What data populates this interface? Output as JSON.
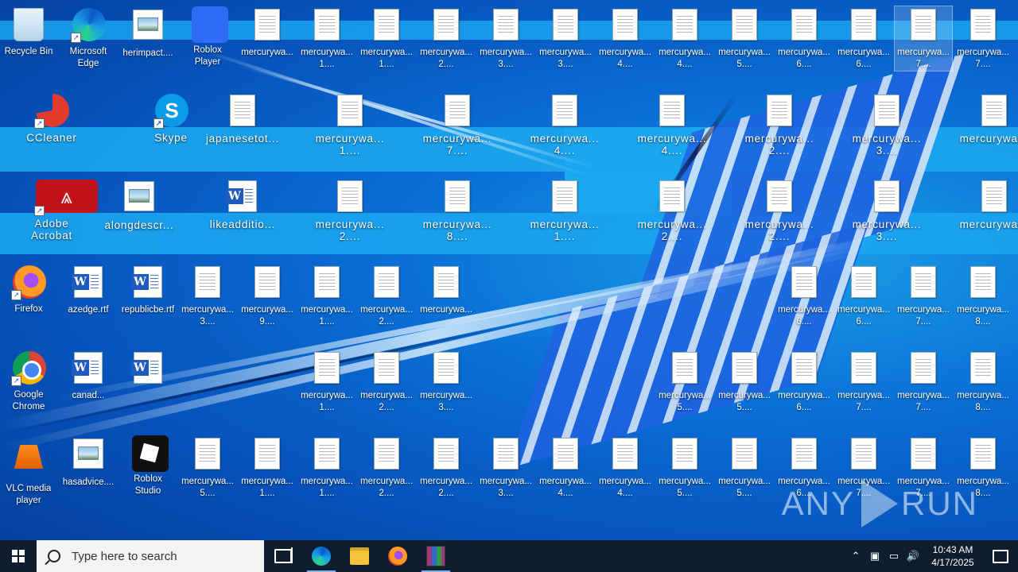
{
  "desktop": {
    "row1": [
      {
        "label": "Recycle Bin",
        "kind": "recycle"
      },
      {
        "label": "Microsoft\nEdge",
        "kind": "edge"
      },
      {
        "label": "herimpact....",
        "kind": "pic"
      },
      {
        "label": "Roblox\nPlayer",
        "kind": "robloxp"
      },
      {
        "label": "mercurywa...",
        "kind": "doc"
      },
      {
        "label": "mercurywa...\n1....",
        "kind": "doc"
      },
      {
        "label": "mercurywa...\n1....",
        "kind": "doc"
      },
      {
        "label": "mercurywa...\n2....",
        "kind": "doc"
      },
      {
        "label": "mercurywa...\n3....",
        "kind": "doc"
      },
      {
        "label": "mercurywa...\n3....",
        "kind": "doc"
      },
      {
        "label": "mercurywa...\n4....",
        "kind": "doc"
      },
      {
        "label": "mercurywa...\n4....",
        "kind": "doc"
      },
      {
        "label": "mercurywa...\n5....",
        "kind": "doc"
      },
      {
        "label": "mercurywa...\n6....",
        "kind": "doc"
      },
      {
        "label": "mercurywa...\n6....",
        "kind": "doc"
      },
      {
        "label": "mercurywa...\n7....",
        "kind": "doc"
      },
      {
        "label": "mercurywa...\n7....",
        "kind": "doc"
      }
    ],
    "row2": [
      {
        "label": "CCleaner",
        "kind": "ccleaner"
      },
      {
        "label": "Skype",
        "kind": "skype"
      },
      {
        "label": "japanesetot...",
        "kind": "doc"
      },
      {
        "label": "mercurywa...\n1....",
        "kind": "doc"
      },
      {
        "label": "mercurywa...\n7....",
        "kind": "doc"
      },
      {
        "label": "mercurywa...\n4....",
        "kind": "doc"
      },
      {
        "label": "mercurywa...\n4....",
        "kind": "doc"
      },
      {
        "label": "mercurywa...\n2....",
        "kind": "doc"
      },
      {
        "label": "mercurywa...\n3....",
        "kind": "doc"
      },
      {
        "label": "mercurywa...",
        "kind": "doc"
      }
    ],
    "row3": [
      {
        "label": "Adobe\nAcrobat",
        "kind": "acrobat"
      },
      {
        "label": "alongdescr...",
        "kind": "pic"
      },
      {
        "label": "likeadditio...",
        "kind": "word"
      },
      {
        "label": "mercurywa...\n2....",
        "kind": "doc"
      },
      {
        "label": "mercurywa...\n8....",
        "kind": "doc"
      },
      {
        "label": "mercurywa...\n1....",
        "kind": "doc"
      },
      {
        "label": "mercurywa...\n2....",
        "kind": "doc"
      },
      {
        "label": "mercurywa...\n2....",
        "kind": "doc"
      },
      {
        "label": "mercurywa...\n3....",
        "kind": "doc"
      },
      {
        "label": "mercurywa...",
        "kind": "doc"
      }
    ],
    "row4": [
      {
        "label": "Firefox",
        "kind": "firefox"
      },
      {
        "label": "azedge.rtf",
        "kind": "word"
      },
      {
        "label": "republicbe.rtf",
        "kind": "word"
      },
      {
        "label": "mercurywa...\n3....",
        "kind": "doc"
      },
      {
        "label": "mercurywa...\n9....",
        "kind": "doc"
      },
      {
        "label": "mercurywa...\n1....",
        "kind": "doc"
      },
      {
        "label": "mercurywa...\n2....",
        "kind": "doc"
      },
      {
        "label": "mercurywa...",
        "kind": "doc"
      },
      {
        "label": "mercurywa...\n6....",
        "kind": "doc"
      },
      {
        "label": "mercurywa...\n6....",
        "kind": "doc"
      },
      {
        "label": "mercurywa...\n7....",
        "kind": "doc"
      },
      {
        "label": "mercurywa...\n8....",
        "kind": "doc"
      }
    ],
    "row5": [
      {
        "label": "Google\nChrome",
        "kind": "chrome"
      },
      {
        "label": "canad...",
        "kind": "word"
      },
      {
        "label": "",
        "kind": "word"
      },
      {
        "label": "mercurywa...\n1....",
        "kind": "doc"
      },
      {
        "label": "mercurywa...\n2....",
        "kind": "doc"
      },
      {
        "label": "mercurywa...\n3....",
        "kind": "doc"
      },
      {
        "label": "mercurywa...\n5....",
        "kind": "doc"
      },
      {
        "label": "mercurywa...\n5....",
        "kind": "doc"
      },
      {
        "label": "mercurywa...\n6....",
        "kind": "doc"
      },
      {
        "label": "mercurywa...\n7....",
        "kind": "doc"
      },
      {
        "label": "mercurywa...\n7....",
        "kind": "doc"
      },
      {
        "label": "mercurywa...\n8....",
        "kind": "doc"
      }
    ],
    "row6": [
      {
        "label": "VLC media\nplayer",
        "kind": "vlc"
      },
      {
        "label": "hasadvice....",
        "kind": "pic"
      },
      {
        "label": "Roblox\nStudio",
        "kind": "roblox"
      },
      {
        "label": "mercurywa...\n5....",
        "kind": "doc"
      },
      {
        "label": "mercurywa...\n1....",
        "kind": "doc"
      },
      {
        "label": "mercurywa...\n1....",
        "kind": "doc"
      },
      {
        "label": "mercurywa...\n2....",
        "kind": "doc"
      },
      {
        "label": "mercurywa...\n2....",
        "kind": "doc"
      },
      {
        "label": "mercurywa...\n3....",
        "kind": "doc"
      },
      {
        "label": "mercurywa...\n4....",
        "kind": "doc"
      },
      {
        "label": "mercurywa...\n4....",
        "kind": "doc"
      },
      {
        "label": "mercurywa...\n5....",
        "kind": "doc"
      },
      {
        "label": "mercurywa...\n5....",
        "kind": "doc"
      },
      {
        "label": "mercurywa...\n6....",
        "kind": "doc"
      },
      {
        "label": "mercurywa...\n7....",
        "kind": "doc"
      },
      {
        "label": "mercurywa...\n7....",
        "kind": "doc"
      },
      {
        "label": "mercurywa...\n8....",
        "kind": "doc"
      }
    ]
  },
  "watermark": {
    "left": "ANY",
    "right": "RUN"
  },
  "taskbar": {
    "search_placeholder": "Type here to search",
    "pinned": [
      "task-view",
      "edge",
      "file-explorer",
      "firefox",
      "winrar"
    ],
    "clock_time": "10:43 AM",
    "clock_date": "4/17/2025",
    "tray_icons": [
      "chevron-up-icon",
      "meet-now-icon",
      "network-icon",
      "volume-icon"
    ]
  }
}
